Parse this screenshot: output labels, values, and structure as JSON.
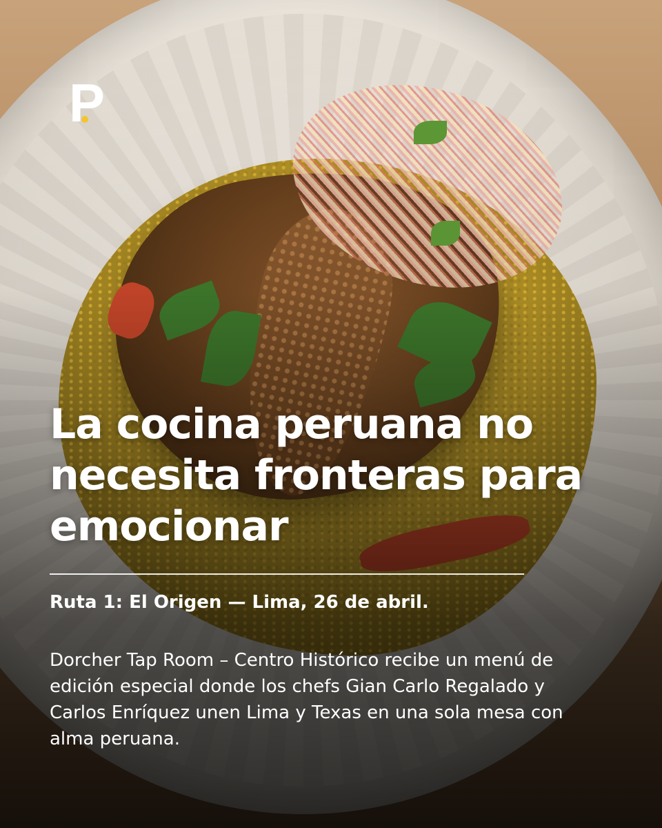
{
  "brand": {
    "logo_letter": "P",
    "accent_color": "#f4c430"
  },
  "post": {
    "headline": "La cocina peruana no necesita fronteras para emocionar",
    "subtitle": "Ruta 1: El Origen — Lima, 26 de abril.",
    "body": "Dorcher Tap Room – Centro Histórico recibe un menú de edición especial donde los chefs Gian Carlo Regalado y Carlos Enríquez unen Lima y Texas en una sola mesa con alma peruana."
  }
}
